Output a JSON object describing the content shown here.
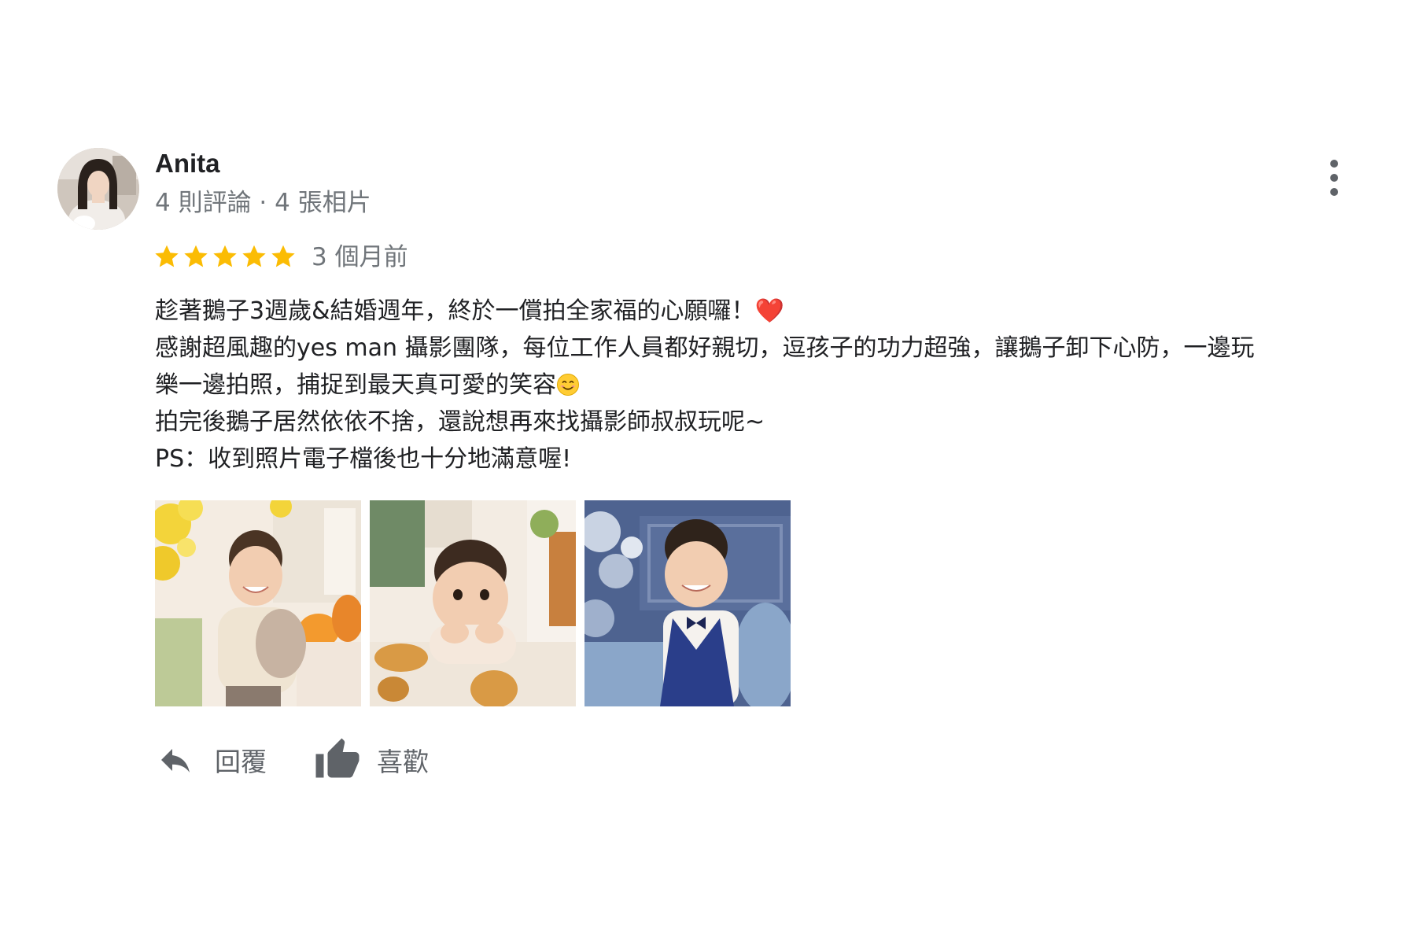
{
  "review": {
    "author": {
      "name": "Anita",
      "meta": "4 則評論 · 4 張相片",
      "avatar_icon": "profile-photo"
    },
    "rating": {
      "stars": 5,
      "max": 5,
      "star_color": "#fbbc04"
    },
    "date": "3 個月前",
    "body": {
      "line1": "趁著鵝子3週歲&結婚週年，終於一償拍全家福的心願囉！",
      "line1_emoji": "❤️",
      "line2": "感謝超風趣的yes man 攝影團隊，每位工作人員都好親切，逗孩子的功力超強，讓鵝子卸下心防，一邊玩",
      "line3": "樂一邊拍照，捕捉到最天真可愛的笑容",
      "line3_emoji": "smile-emoji",
      "line4": "拍完後鵝子居然依依不捨，還說想再來找攝影師叔叔玩呢~",
      "line5": "PS：收到照片電子檔後也十分地滿意喔!"
    },
    "photos": [
      {
        "subject": "boy-with-pumpkins-yellow-flowers"
      },
      {
        "subject": "boy-chin-on-hands-with-bread"
      },
      {
        "subject": "boy-in-blue-vest-bowtie"
      }
    ],
    "actions": {
      "reply_label": "回覆",
      "like_label": "喜歡"
    },
    "colors": {
      "text_primary": "#202124",
      "text_secondary": "#70757a",
      "icon_gray": "#5f6368"
    }
  }
}
